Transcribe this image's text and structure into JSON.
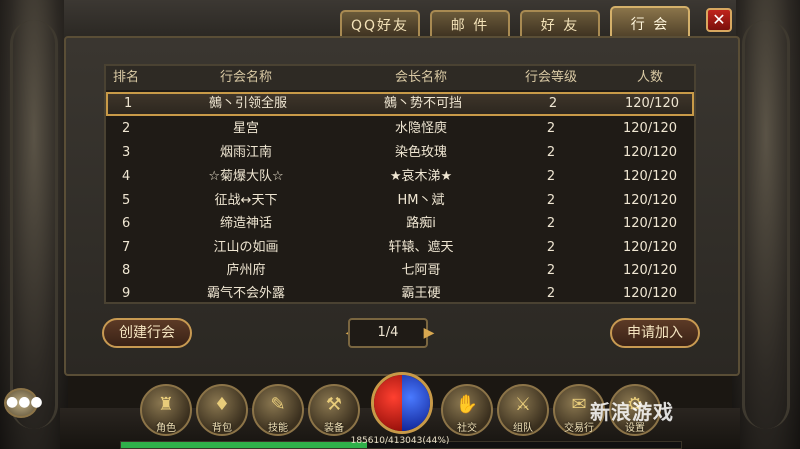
{
  "tabs": [
    {
      "label": "QQ好友",
      "active": false
    },
    {
      "label": "邮 件",
      "active": false
    },
    {
      "label": "好 友",
      "active": false
    },
    {
      "label": "行 会",
      "active": true
    }
  ],
  "close_icon": "✕",
  "table": {
    "headers": [
      "排名",
      "行会名称",
      "会长名称",
      "行会等级",
      "人数"
    ],
    "rows": [
      {
        "rank": "1",
        "guild": "鵺丶引领全服",
        "leader": "鵺丶势不可挡",
        "level": "2",
        "members": "120/120"
      },
      {
        "rank": "2",
        "guild": "星宫",
        "leader": "水隐怪庾",
        "level": "2",
        "members": "120/120"
      },
      {
        "rank": "3",
        "guild": "烟雨江南",
        "leader": "染色玫瑰",
        "level": "2",
        "members": "120/120"
      },
      {
        "rank": "4",
        "guild": "☆菊爆大队☆",
        "leader": "★哀木涕★",
        "level": "2",
        "members": "120/120"
      },
      {
        "rank": "5",
        "guild": "征战↔天下",
        "leader": "HM丶斌",
        "level": "2",
        "members": "120/120"
      },
      {
        "rank": "6",
        "guild": "缔造神话",
        "leader": "路痴i",
        "level": "2",
        "members": "120/120"
      },
      {
        "rank": "7",
        "guild": "江山の如画",
        "leader": "轩辕、遮天",
        "level": "2",
        "members": "120/120"
      },
      {
        "rank": "8",
        "guild": "庐州府",
        "leader": "七阿哥",
        "level": "2",
        "members": "120/120"
      },
      {
        "rank": "9",
        "guild": "霸气不会外露",
        "leader": "霸王硬",
        "level": "2",
        "members": "120/120"
      }
    ]
  },
  "buttons": {
    "create": "创建行会",
    "join": "申请加入"
  },
  "pager": {
    "text": "1/4",
    "prev": "◀",
    "next": "▶"
  },
  "skills": [
    {
      "label": "角色",
      "icon": "character-icon",
      "glyph": "♜"
    },
    {
      "label": "背包",
      "icon": "bag-icon",
      "glyph": "♦"
    },
    {
      "label": "技能",
      "icon": "skill-book-icon",
      "glyph": "✎"
    },
    {
      "label": "装备",
      "icon": "equipment-icon",
      "glyph": "⚒"
    },
    {
      "label": "社交",
      "icon": "social-icon",
      "glyph": "✋"
    },
    {
      "label": "组队",
      "icon": "team-icon",
      "glyph": "⚔"
    },
    {
      "label": "交易行",
      "icon": "trade-icon",
      "glyph": "✉"
    },
    {
      "label": "设置",
      "icon": "settings-icon",
      "glyph": "⚙"
    }
  ],
  "exp": {
    "text": "185610/413043(44%)",
    "fraction": 0.44
  },
  "chat_icon": "●●●",
  "watermark": "新浪游戏"
}
